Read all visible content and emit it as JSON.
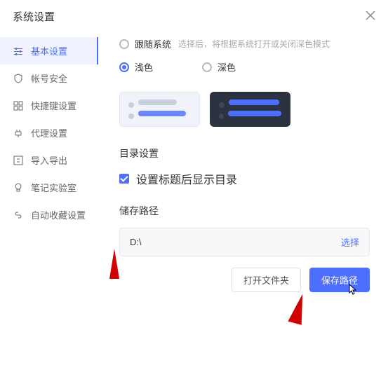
{
  "header": {
    "title": "系统设置"
  },
  "sidebar": {
    "items": [
      {
        "label": "基本设置"
      },
      {
        "label": "帐号安全"
      },
      {
        "label": "快捷键设置"
      },
      {
        "label": "代理设置"
      },
      {
        "label": "导入导出"
      },
      {
        "label": "笔记实验室"
      },
      {
        "label": "自动收藏设置"
      }
    ]
  },
  "theme": {
    "followSystemLabel": "跟随系统",
    "followSystemDesc": "选择后，将根据系统打开或关闭深色模式",
    "lightLabel": "浅色",
    "darkLabel": "深色"
  },
  "directory": {
    "title": "目录设置",
    "showAfterTitleLabel": "设置标题后显示目录"
  },
  "storage": {
    "title": "储存路径",
    "pathValue": "D:\\",
    "selectLabel": "选择",
    "openFolderLabel": "打开文件夹",
    "savePathLabel": "保存路径"
  }
}
